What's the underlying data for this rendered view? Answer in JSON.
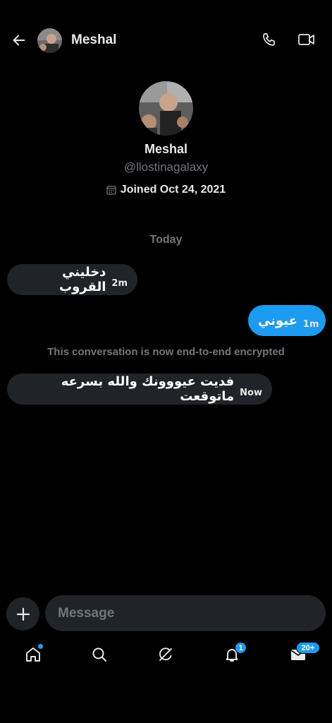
{
  "header": {
    "back_icon": "arrow-left-icon",
    "name": "Meshal",
    "call_icon": "phone-icon",
    "video_icon": "video-camera-icon"
  },
  "profile": {
    "name": "Meshal",
    "handle": "@llostinagalaxy",
    "joined": "Joined Oct 24, 2021",
    "calendar_icon": "calendar-icon"
  },
  "conversation": {
    "date_divider": "Today",
    "encrypted_notice": "This conversation is now end-to-end encrypted",
    "messages": [
      {
        "direction": "incoming",
        "text": "دخليني القروب",
        "time": "2m"
      },
      {
        "direction": "outgoing",
        "text": "عيوني",
        "time": "1m"
      },
      {
        "direction": "incoming",
        "text": "فديت عيووونك والله بسرعه ماتوقعت",
        "time": "Now"
      }
    ]
  },
  "composer": {
    "add_icon": "plus-icon",
    "placeholder": "Message"
  },
  "nav": {
    "home_icon": "home-icon",
    "search_icon": "search-icon",
    "grok_icon": "grok-icon",
    "notifications_icon": "bell-icon",
    "notifications_badge": "1",
    "messages_icon": "envelope-icon",
    "messages_badge": "20+"
  },
  "colors": {
    "background": "#000000",
    "bubble_incoming": "#202327",
    "bubble_outgoing": "#1d9bf0",
    "muted_text": "#71767b",
    "accent": "#1d9bf0"
  }
}
